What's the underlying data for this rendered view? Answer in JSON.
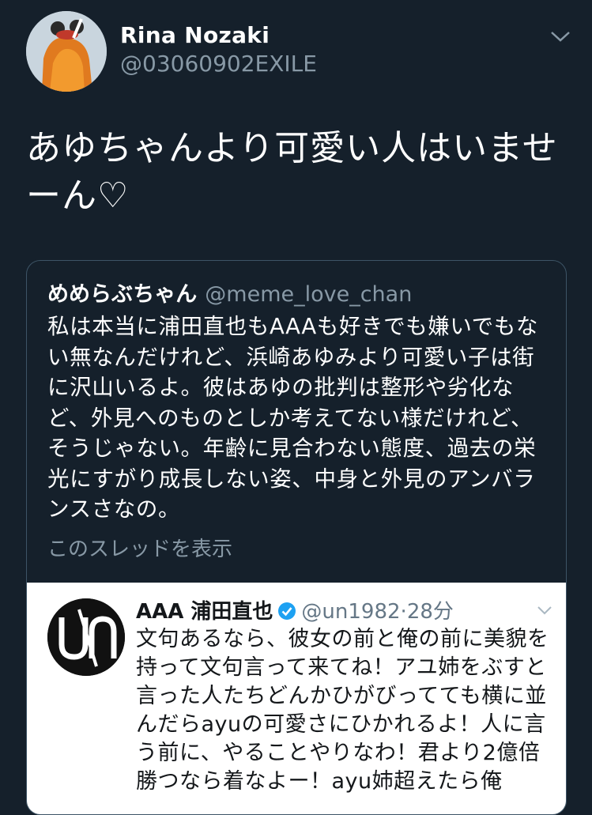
{
  "tweet": {
    "author_name": "Rina Nozaki",
    "author_handle": "@03060902EXILE",
    "text": "あゆちゃんより可愛い人はいませーん♡"
  },
  "quote": {
    "author_name": "めめらぶちゃん",
    "author_handle": "@meme_love_chan",
    "text": "私は本当に浦田直也もAAAも好きでも嫌いでもない無なんだけれど、浜崎あゆみより可愛い子は街に沢山いるよ。彼はあゆの批判は整形や劣化など、外見へのものとしか考えてない様だけれど、そうじゃない。年齢に見合わない態度、過去の栄光にすがり成長しない姿、中身と外見のアンバランスさなの。",
    "show_thread": "このスレッドを表示"
  },
  "embedded": {
    "author_name": "AAA 浦田直也",
    "author_handle": "@un1982",
    "separator": "·",
    "time": "28分",
    "text": "文句あるなら、彼女の前と俺の前に美貌を持って文句言って来てね！アユ姉をぶすと言った人たちどんかひがびってても横に並んだらayuの可愛さにひかれるよ！人に言う前に、やることやりなわ！君より2億倍勝つなら着なよー！ayu姉超えたら俺",
    "avatar_icon": "un-logo-icon"
  },
  "colors": {
    "background": "#15202b",
    "secondary_text": "#8899a6",
    "card_border": "#3d5466",
    "verified": "#1da1f2"
  }
}
